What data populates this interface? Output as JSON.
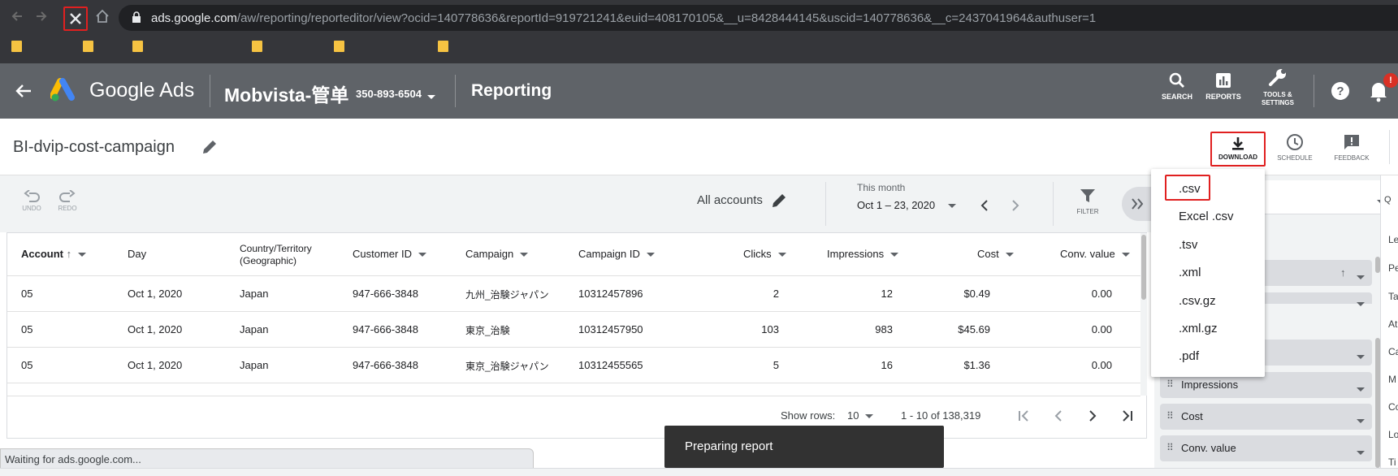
{
  "browser": {
    "url_host": "ads.google.com",
    "url_path": "/aw/reporting/reporteditor/view?ocid=140778636&reportId=919721241&euid=408170105&__u=8428444145&uscid=140778636&__c=2437041964&authuser=1",
    "status_text": "Waiting for ads.google.com..."
  },
  "header": {
    "product_name": "Google Ads",
    "account_name": "Mobvista-管单",
    "account_id": "350-893-6504",
    "section_title": "Reporting",
    "buttons": {
      "search": "SEARCH",
      "reports": "REPORTS",
      "tools_line1": "TOOLS &",
      "tools_line2": "SETTINGS"
    },
    "notification_badge": "!"
  },
  "report": {
    "title": "BI-dvip-cost-campaign",
    "actions": {
      "download": "DOWNLOAD",
      "schedule": "SCHEDULE",
      "feedback": "FEEDBACK"
    }
  },
  "toolbar": {
    "undo": "UNDO",
    "redo": "REDO",
    "accounts": "All accounts",
    "date_label": "This month",
    "date_range": "Oct 1 – 23, 2020",
    "filter": "FILTER"
  },
  "table": {
    "columns": [
      "Account",
      "Day",
      "Country/Territory",
      "(Geographic)",
      "Customer ID",
      "Campaign",
      "Campaign ID",
      "Clicks",
      "Impressions",
      "Cost",
      "Conv. value"
    ],
    "rows": [
      [
        "05",
        "Oct 1, 2020",
        "Japan",
        "947-666-3848",
        "九州_治験ジャパン",
        "10312457896",
        "2",
        "12",
        "$0.49",
        "0.00"
      ],
      [
        "05",
        "Oct 1, 2020",
        "Japan",
        "947-666-3848",
        "東京_治験",
        "10312457950",
        "103",
        "983",
        "$45.69",
        "0.00"
      ],
      [
        "05",
        "Oct 1, 2020",
        "Japan",
        "947-666-3848",
        "東京_治験ジャパン",
        "10312455565",
        "5",
        "16",
        "$1.36",
        "0.00"
      ]
    ],
    "pagination": {
      "show_rows_label": "Show rows:",
      "rows_per_page": "10",
      "range": "1 - 10 of 138,319"
    }
  },
  "download_menu": {
    "formats": [
      ".csv",
      "Excel .csv",
      ".tsv",
      ".xml",
      ".csv.gz",
      ".xml.gz",
      ".pdf"
    ],
    "selected": ".csv"
  },
  "right_panel": {
    "chips": [
      "Impressions",
      "Cost",
      "Conv. value"
    ],
    "side_letters": [
      "Le",
      "Pe",
      "Ta",
      "At",
      "Ca",
      "M",
      "Co",
      "Lo",
      "Ti"
    ]
  },
  "toast": {
    "message": "Preparing report"
  },
  "colors": {
    "header_bg": "#5f6368",
    "browser_bg": "#35363a",
    "highlight_red": "#e02020",
    "toast_bg": "#323232"
  }
}
